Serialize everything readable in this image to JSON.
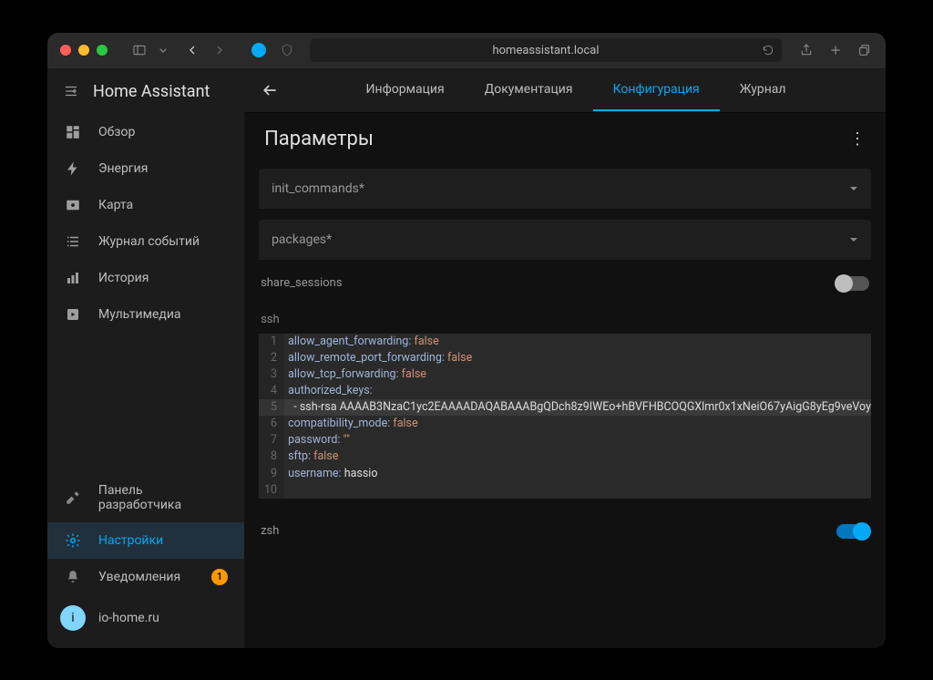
{
  "browser": {
    "url": "homeassistant.local"
  },
  "app_title": "Home Assistant",
  "sidebar": {
    "items": [
      {
        "label": "Обзор"
      },
      {
        "label": "Энергия"
      },
      {
        "label": "Карта"
      },
      {
        "label": "Журнал событий"
      },
      {
        "label": "История"
      },
      {
        "label": "Мультимедиа"
      }
    ],
    "dev": {
      "label": "Панель разработчика"
    },
    "settings": {
      "label": "Настройки"
    },
    "notifications": {
      "label": "Уведомления",
      "count": "1"
    },
    "user": {
      "label": "io-home.ru",
      "initial": "i"
    }
  },
  "tabs": [
    {
      "label": "Информация"
    },
    {
      "label": "Документация"
    },
    {
      "label": "Конфигурация",
      "active": true
    },
    {
      "label": "Журнал"
    }
  ],
  "page": {
    "title": "Параметры",
    "fields": {
      "init_commands": "init_commands*",
      "packages": "packages*",
      "share_sessions": "share_sessions",
      "ssh": "ssh",
      "zsh": "zsh"
    },
    "toggles": {
      "share_sessions": false,
      "zsh": true
    },
    "ssh_config": {
      "lines": [
        {
          "n": "1",
          "key": "allow_agent_forwarding",
          "val": "false",
          "type": "bool"
        },
        {
          "n": "2",
          "key": "allow_remote_port_forwarding",
          "val": "false",
          "type": "bool"
        },
        {
          "n": "3",
          "key": "allow_tcp_forwarding",
          "val": "false",
          "type": "bool"
        },
        {
          "n": "4",
          "key": "authorized_keys",
          "val": "",
          "type": "key"
        },
        {
          "n": "5",
          "raw": "  - ssh-rsa AAAAB3NzaC1yc2EAAAADAQABAAABgQDch8z9IWEo+hBVFHBCOQGXlmr0x1xNeiO67yAigG8yEg9veVoy",
          "type": "item",
          "hl": true
        },
        {
          "n": "6",
          "key": "compatibility_mode",
          "val": "false",
          "type": "bool"
        },
        {
          "n": "7",
          "key": "password",
          "val": "\"\"",
          "type": "str"
        },
        {
          "n": "8",
          "key": "sftp",
          "val": "false",
          "type": "bool"
        },
        {
          "n": "9",
          "key": "username",
          "val": "hassio",
          "type": "plain"
        },
        {
          "n": "10",
          "raw": "",
          "type": "empty"
        }
      ]
    }
  }
}
